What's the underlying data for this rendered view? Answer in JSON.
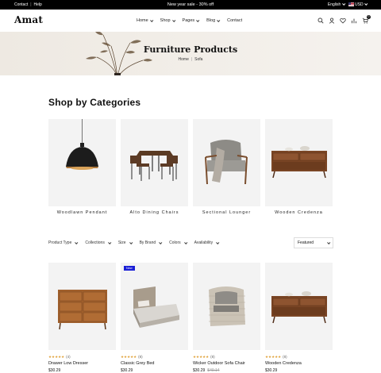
{
  "topbar": {
    "contact": "Contact",
    "help": "Help",
    "promo": "New year sale - 30% off",
    "language": "English",
    "currency": "USD"
  },
  "nav": {
    "logo": "Amat",
    "menu": [
      "Home",
      "Shop",
      "Pages",
      "Blog",
      "Contact"
    ],
    "cart_count": "0"
  },
  "hero": {
    "title": "Furniture Products",
    "breadcrumb": [
      "Home",
      "Sofa"
    ]
  },
  "categories": {
    "title": "Shop by Categories",
    "items": [
      {
        "label": "Woodlawn Pendant",
        "icon": "pendant-lamp-image"
      },
      {
        "label": "Alto Dining Chairs",
        "icon": "dining-set-image"
      },
      {
        "label": "Sectional Lounger",
        "icon": "lounge-chair-image"
      },
      {
        "label": "Wooden Credenza",
        "icon": "credenza-image"
      }
    ]
  },
  "filters": {
    "items": [
      "Product Type",
      "Collections",
      "Size",
      "By Brand",
      "Colors",
      "Availability"
    ],
    "sort": "Featured"
  },
  "products": [
    {
      "name": "Drawer Low Dresser",
      "price": "$30.29",
      "old_price": "",
      "reviews": "(4)",
      "rating": 5,
      "badge": ""
    },
    {
      "name": "Classic Grey Bed",
      "price": "$30.29",
      "old_price": "",
      "reviews": "(8)",
      "rating": 5,
      "badge": "New"
    },
    {
      "name": "Wicker Outdoor Sofa Chair",
      "price": "$30.29",
      "old_price": "$40.14",
      "reviews": "(8)",
      "rating": 5,
      "badge": ""
    },
    {
      "name": "Wooden Credenza",
      "price": "$30.29",
      "old_price": "",
      "reviews": "(8)",
      "rating": 5,
      "badge": ""
    }
  ],
  "colors": {
    "accent": "#1a1fd6",
    "star": "#e0a23a",
    "topbar": "#000000"
  }
}
